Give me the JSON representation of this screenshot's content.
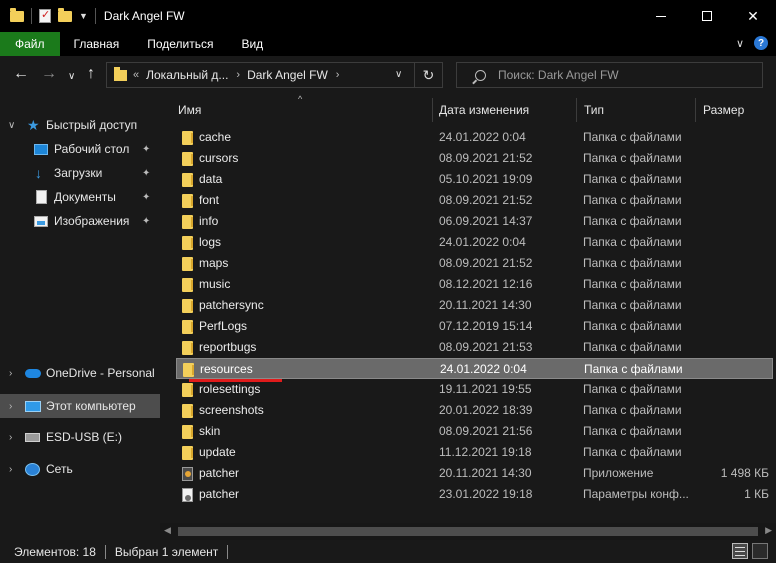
{
  "window": {
    "title": "Dark Angel FW",
    "controls": {
      "minimize": "—",
      "maximize": "□",
      "close": "✕"
    }
  },
  "ribbon": {
    "tabs": [
      "Файл",
      "Главная",
      "Поделиться",
      "Вид"
    ],
    "collapse": "∨",
    "help": "?"
  },
  "nav": {
    "back": "←",
    "forward": "→",
    "recent": "∨",
    "up": "↑",
    "address": {
      "overflow": "«",
      "parts": [
        "Локальный д...",
        "Dark Angel FW"
      ],
      "separator": "›",
      "dropdown": "∨",
      "refresh": "↻"
    },
    "search": {
      "placeholder": "Поиск: Dark Angel FW"
    }
  },
  "sidebar": {
    "quick_access": {
      "label": "Быстрый доступ",
      "items": [
        {
          "label": "Рабочий стол",
          "icon": "desktop-icon"
        },
        {
          "label": "Загрузки",
          "icon": "downloads-icon"
        },
        {
          "label": "Документы",
          "icon": "documents-icon"
        },
        {
          "label": "Изображения",
          "icon": "pictures-icon"
        }
      ]
    },
    "onedrive": "OneDrive - Personal",
    "this_pc": "Этот компьютер",
    "usb": "ESD-USB (E:)",
    "network": "Сеть",
    "pin_glyph": "📌"
  },
  "columns": {
    "name": "Имя",
    "date": "Дата изменения",
    "type": "Тип",
    "size": "Размер"
  },
  "files": [
    {
      "name": "cache",
      "date": "24.01.2022 0:04",
      "type": "Папка с файлами",
      "size": "",
      "kind": "folder"
    },
    {
      "name": "cursors",
      "date": "08.09.2021 21:52",
      "type": "Папка с файлами",
      "size": "",
      "kind": "folder"
    },
    {
      "name": "data",
      "date": "05.10.2021 19:09",
      "type": "Папка с файлами",
      "size": "",
      "kind": "folder"
    },
    {
      "name": "font",
      "date": "08.09.2021 21:52",
      "type": "Папка с файлами",
      "size": "",
      "kind": "folder"
    },
    {
      "name": "info",
      "date": "06.09.2021 14:37",
      "type": "Папка с файлами",
      "size": "",
      "kind": "folder"
    },
    {
      "name": "logs",
      "date": "24.01.2022 0:04",
      "type": "Папка с файлами",
      "size": "",
      "kind": "folder"
    },
    {
      "name": "maps",
      "date": "08.09.2021 21:52",
      "type": "Папка с файлами",
      "size": "",
      "kind": "folder"
    },
    {
      "name": "music",
      "date": "08.12.2021 12:16",
      "type": "Папка с файлами",
      "size": "",
      "kind": "folder"
    },
    {
      "name": "patchersync",
      "date": "20.11.2021 14:30",
      "type": "Папка с файлами",
      "size": "",
      "kind": "folder"
    },
    {
      "name": "PerfLogs",
      "date": "07.12.2019 15:14",
      "type": "Папка с файлами",
      "size": "",
      "kind": "folder"
    },
    {
      "name": "reportbugs",
      "date": "08.09.2021 21:53",
      "type": "Папка с файлами",
      "size": "",
      "kind": "folder"
    },
    {
      "name": "resources",
      "date": "24.01.2022 0:04",
      "type": "Папка с файлами",
      "size": "",
      "kind": "folder",
      "selected": true
    },
    {
      "name": "rolesettings",
      "date": "19.11.2021 19:55",
      "type": "Папка с файлами",
      "size": "",
      "kind": "folder"
    },
    {
      "name": "screenshots",
      "date": "20.01.2022 18:39",
      "type": "Папка с файлами",
      "size": "",
      "kind": "folder"
    },
    {
      "name": "skin",
      "date": "08.09.2021 21:56",
      "type": "Папка с файлами",
      "size": "",
      "kind": "folder"
    },
    {
      "name": "update",
      "date": "11.12.2021 19:18",
      "type": "Папка с файлами",
      "size": "",
      "kind": "folder"
    },
    {
      "name": "patcher",
      "date": "20.11.2021 14:30",
      "type": "Приложение",
      "size": "1 498 КБ",
      "kind": "exe"
    },
    {
      "name": "patcher",
      "date": "23.01.2022 19:18",
      "type": "Параметры конф...",
      "size": "1 КБ",
      "kind": "cfg"
    }
  ],
  "status": {
    "count": "Элементов: 18",
    "selected": "Выбран 1 элемент"
  },
  "colors": {
    "background": "#191919",
    "selection": "#6a6a6a",
    "file_tab": "#1b7a1b",
    "folder": "#f3cf5a",
    "underline": "#e01b1b"
  }
}
